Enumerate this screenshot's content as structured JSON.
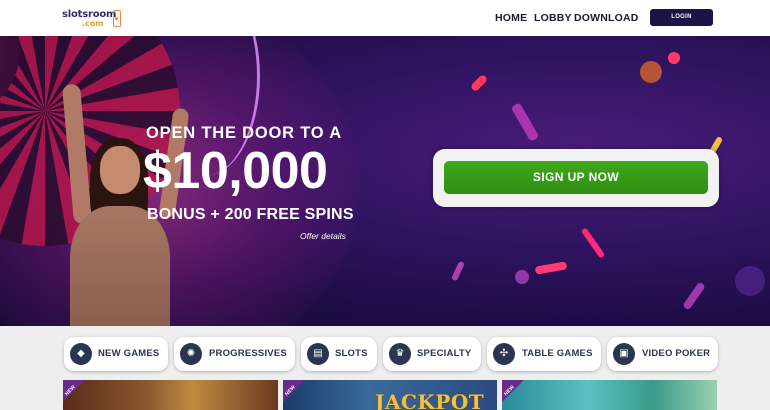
{
  "header": {
    "logo_line1": "slotsroom",
    "logo_line2": ".com",
    "nav": [
      "HOME",
      "LOBBY",
      "DOWNLOAD"
    ],
    "login_label": "LOGIN"
  },
  "hero": {
    "line1": "OPEN THE DOOR TO A",
    "amount": "$10,000",
    "line2": "BONUS + 200 FREE SPINS",
    "offer_details": "Offer details",
    "signup_label": "SIGN UP NOW"
  },
  "categories": [
    {
      "label": "NEW GAMES",
      "icon": "diamond-icon",
      "glyph": "◆"
    },
    {
      "label": "PROGRESSIVES",
      "icon": "chip-icon",
      "glyph": "✺"
    },
    {
      "label": "SLOTS",
      "icon": "slot-machine-icon",
      "glyph": "▤"
    },
    {
      "label": "SPECIALTY",
      "icon": "crown-icon",
      "glyph": "♛"
    },
    {
      "label": "TABLE GAMES",
      "icon": "cards-icon",
      "glyph": "✣"
    },
    {
      "label": "VIDEO POKER",
      "icon": "poker-card-icon",
      "glyph": "▣"
    }
  ],
  "game_tiles": [
    {
      "badge": "NEW"
    },
    {
      "badge": "NEW",
      "title": "JACKPOT"
    },
    {
      "badge": "NEW"
    }
  ],
  "colors": {
    "login_bg": "#1a1447",
    "signup_green": "#3fa81c",
    "hero_bg": "#321463",
    "category_icon_bg": "#2a3550"
  }
}
